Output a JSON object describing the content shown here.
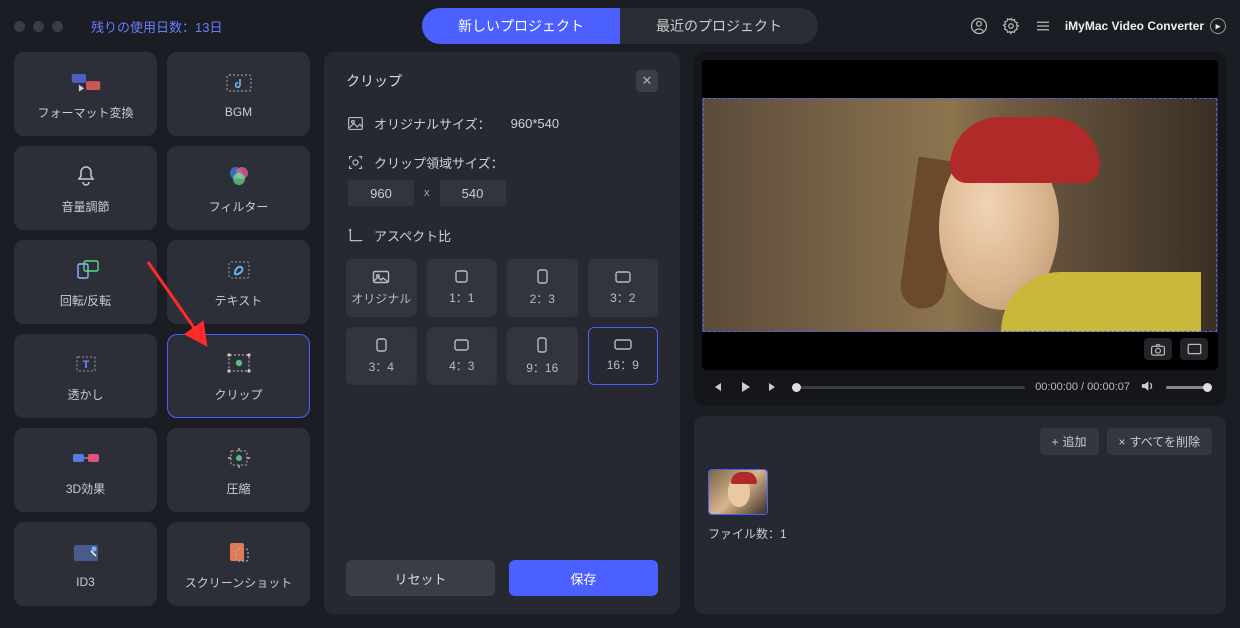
{
  "topbar": {
    "trial_text": "残りの使用日数：13日",
    "tabs": {
      "new": "新しいプロジェクト",
      "recent": "最近のプロジェクト"
    },
    "app_name": "iMyMac Video Converter"
  },
  "tools": {
    "format": "フォーマット変換",
    "bgm": "BGM",
    "volume": "音量調節",
    "filter": "フィルター",
    "rotate": "回転/反転",
    "text": "テキスト",
    "watermark": "透かし",
    "clip": "クリップ",
    "effect3d": "3D効果",
    "compress": "圧縮",
    "id3": "ID3",
    "screenshot": "スクリーンショット"
  },
  "clip_panel": {
    "title": "クリップ",
    "original_size_label": "オリジナルサイズ：",
    "original_size_value": "960*540",
    "crop_size_label": "クリップ領域サイズ：",
    "width": "960",
    "height": "540",
    "aspect_label": "アスペクト比",
    "aspects": {
      "original": "オリジナル",
      "a1_1": "1：1",
      "a2_3": "2：3",
      "a3_2": "3：2",
      "a3_4": "3：4",
      "a4_3": "4：3",
      "a9_16": "9：16",
      "a16_9": "16：9"
    },
    "reset": "リセット",
    "save": "保存"
  },
  "player": {
    "time": "00:00:00 / 00:00:07"
  },
  "files": {
    "add": "追加",
    "delete_all": "すべてを削除",
    "count_label": "ファイル数：1"
  }
}
